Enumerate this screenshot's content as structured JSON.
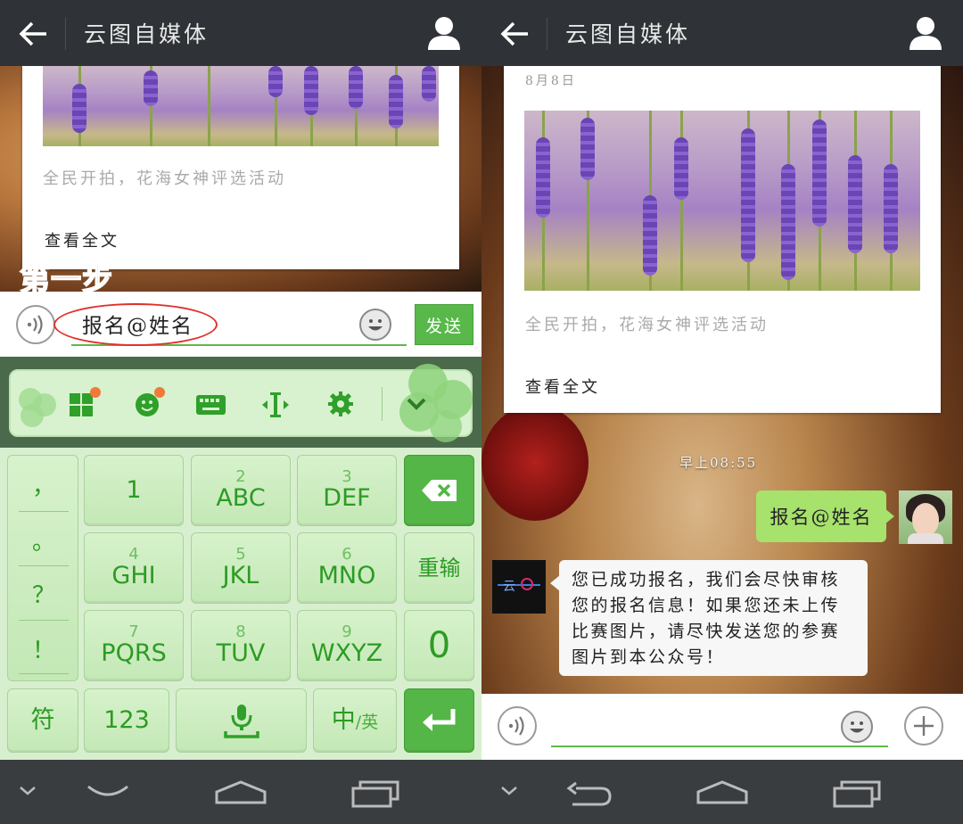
{
  "title": "云图自媒体",
  "article": {
    "date": "8月8日",
    "summary": "全民开拍，花海女神评选活动",
    "read_more": "查看全文"
  },
  "left": {
    "annotation": "第一步",
    "input_value": "报名@姓名",
    "send_label": "发送",
    "keyboard": {
      "toolbar_icons": [
        "grid-icon",
        "emoji-icon",
        "keyboard-icon",
        "cursor-icon",
        "settings-icon",
        "collapse-icon"
      ],
      "punctuation": [
        "，",
        "。",
        "？",
        "！"
      ],
      "rows": [
        [
          {
            "num": "",
            "label": "1"
          },
          {
            "num": "2",
            "label": "ABC"
          },
          {
            "num": "3",
            "label": "DEF"
          }
        ],
        [
          {
            "num": "4",
            "label": "GHI"
          },
          {
            "num": "5",
            "label": "JKL"
          },
          {
            "num": "6",
            "label": "MNO"
          }
        ],
        [
          {
            "num": "7",
            "label": "PQRS"
          },
          {
            "num": "8",
            "label": "TUV"
          },
          {
            "num": "9",
            "label": "WXYZ"
          }
        ]
      ],
      "reinput": "重输",
      "zero": "0",
      "symbol": "符",
      "num_mode": "123",
      "lang_main": "中",
      "lang_sub": "/英"
    }
  },
  "right": {
    "time": "早上08:55",
    "sent_message": "报名@姓名",
    "reply_message": "您已成功报名，我们会尽快审核您的报名信息！如果您还未上传比赛图片，请尽快发送您的参赛图片到本公众号！",
    "logo_text": "云"
  },
  "colors": {
    "titlebar": "#2f3337",
    "accent_green": "#58b84a",
    "bubble_green": "#a6e26c",
    "annotation_red": "#e53225"
  }
}
